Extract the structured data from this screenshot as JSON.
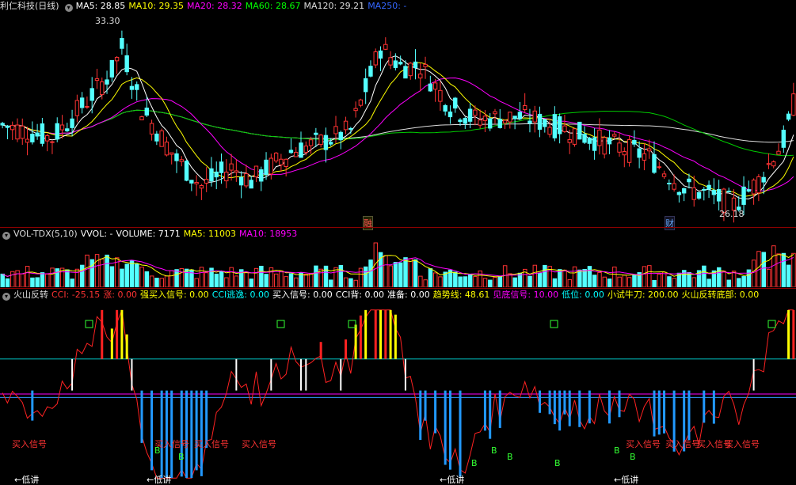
{
  "main": {
    "title": "利仁科技(日线)",
    "ma": [
      {
        "label": "MA5: 28.85",
        "color": "#ffffff"
      },
      {
        "label": "MA10: 29.35",
        "color": "#ffff00"
      },
      {
        "label": "MA20: 28.32",
        "color": "#ff00ff"
      },
      {
        "label": "MA60: 28.67",
        "color": "#00ff00"
      },
      {
        "label": "MA120: 29.21",
        "color": "#dddddd"
      },
      {
        "label": "MA250: -",
        "color": "#3366ff"
      }
    ],
    "high_label": "33.30",
    "low_label": "26.18",
    "markers": [
      "融",
      "财"
    ]
  },
  "vol": {
    "title": "VOL-TDX(5,10)",
    "items": [
      {
        "label": "VVOL: -",
        "color": "#ffffff"
      },
      {
        "label": "VOLUME: 7171",
        "color": "#ffffff"
      },
      {
        "label": "MA5: 11003",
        "color": "#ffff00"
      },
      {
        "label": "MA10: 18953",
        "color": "#ff00ff"
      }
    ]
  },
  "ind": {
    "title": "火山反转",
    "items": [
      {
        "label": "CCI: -25.15",
        "color": "#ff3333"
      },
      {
        "label": "涨: 0.00",
        "color": "#ff3333"
      },
      {
        "label": "强买入信号: 0.00",
        "color": "#ffff00"
      },
      {
        "label": "CCI逃逸: 0.00",
        "color": "#00ffff"
      },
      {
        "label": "买入信号: 0.00",
        "color": "#ffffff"
      },
      {
        "label": "CCI背: 0.00",
        "color": "#ffffff"
      },
      {
        "label": "准备: 0.00",
        "color": "#ffffff"
      },
      {
        "label": "趋势线: 48.61",
        "color": "#ffff00"
      },
      {
        "label": "见底信号: 10.00",
        "color": "#ff00ff"
      },
      {
        "label": "低位: 0.00",
        "color": "#00ffff"
      },
      {
        "label": "小试牛刀: 200.00",
        "color": "#ffff00"
      },
      {
        "label": "火山反转底部: 0.00",
        "color": "#ffff00"
      }
    ],
    "buy_text": "买入信号",
    "low_text": "←低讲",
    "b_text": "B",
    "box_text": "回"
  }
}
